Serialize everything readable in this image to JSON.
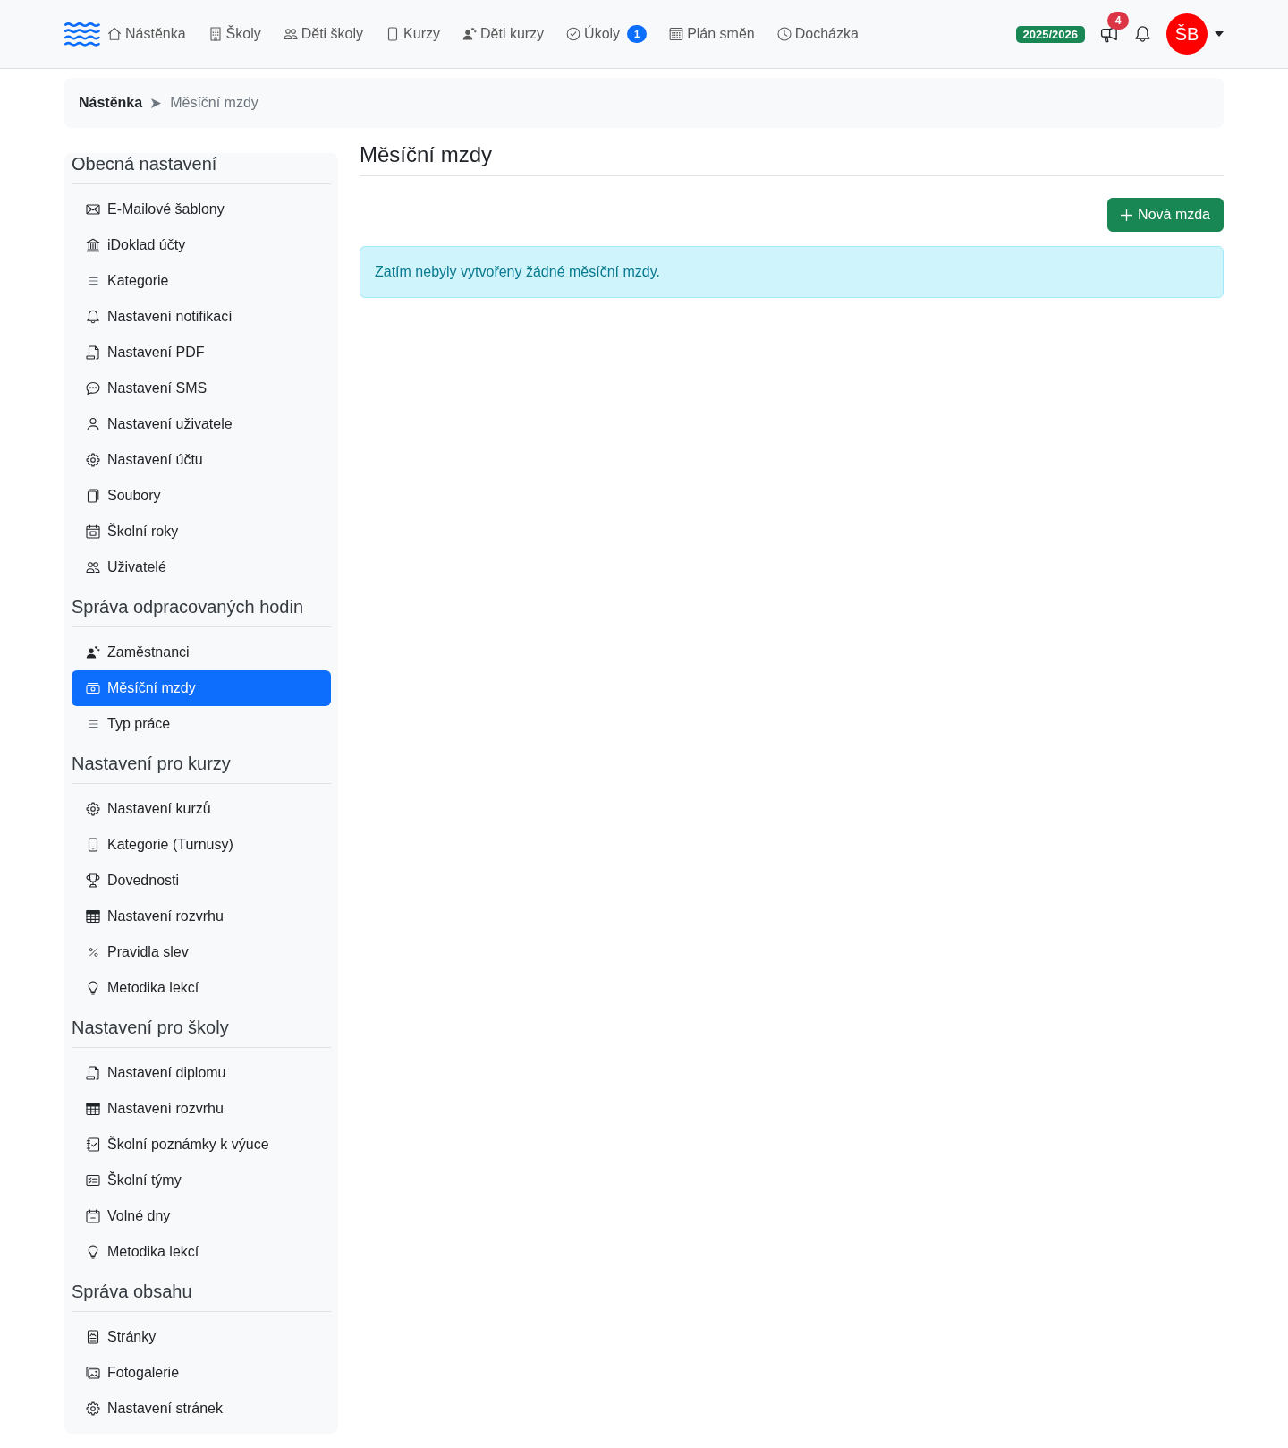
{
  "navbar": {
    "links": [
      {
        "label": "Nástěnka"
      },
      {
        "label": "Školy"
      },
      {
        "label": "Děti školy"
      },
      {
        "label": "Kurzy"
      },
      {
        "label": "Děti kurzy"
      },
      {
        "label": "Úkoly",
        "badge": "1"
      },
      {
        "label": "Plán směn"
      },
      {
        "label": "Docházka"
      }
    ],
    "school_year": "2025/2026",
    "announcements_count": "4",
    "user_initials": "ŠB"
  },
  "breadcrumb": [
    {
      "label": "Nástěnka",
      "current": false
    },
    {
      "label": "Měsíční mzdy",
      "current": true
    }
  ],
  "sidebar": {
    "sections": [
      {
        "title": "Obecná nastavení",
        "items": [
          {
            "label": "E-Mailové šablony",
            "selected": false
          },
          {
            "label": "iDoklad účty",
            "selected": false
          },
          {
            "label": "Kategorie",
            "selected": false
          },
          {
            "label": "Nastavení notifikací",
            "selected": false
          },
          {
            "label": "Nastavení PDF",
            "selected": false
          },
          {
            "label": "Nastavení SMS",
            "selected": false
          },
          {
            "label": "Nastavení uživatele",
            "selected": false
          },
          {
            "label": "Nastavení účtu",
            "selected": false
          },
          {
            "label": "Soubory",
            "selected": false
          },
          {
            "label": "Školní roky",
            "selected": false
          },
          {
            "label": "Uživatelé",
            "selected": false
          }
        ]
      },
      {
        "title": "Správa odpracovaných hodin",
        "items": [
          {
            "label": "Zaměstnanci",
            "selected": false
          },
          {
            "label": "Měsíční mzdy",
            "selected": true
          },
          {
            "label": "Typ práce",
            "selected": false
          }
        ]
      },
      {
        "title": "Nastavení pro kurzy",
        "items": [
          {
            "label": "Nastavení kurzů",
            "selected": false
          },
          {
            "label": "Kategorie (Turnusy)",
            "selected": false
          },
          {
            "label": "Dovednosti",
            "selected": false
          },
          {
            "label": "Nastavení rozvrhu",
            "selected": false
          },
          {
            "label": "Pravidla slev",
            "selected": false
          },
          {
            "label": "Metodika lekcí",
            "selected": false
          }
        ]
      },
      {
        "title": "Nastavení pro školy",
        "items": [
          {
            "label": "Nastavení diplomu",
            "selected": false
          },
          {
            "label": "Nastavení rozvrhu",
            "selected": false
          },
          {
            "label": "Školní poznámky k výuce",
            "selected": false
          },
          {
            "label": "Školní týmy",
            "selected": false
          },
          {
            "label": "Volné dny",
            "selected": false
          },
          {
            "label": "Metodika lekcí",
            "selected": false
          }
        ]
      },
      {
        "title": "Správa obsahu",
        "items": [
          {
            "label": "Stránky",
            "selected": false
          },
          {
            "label": "Fotogalerie",
            "selected": false
          },
          {
            "label": "Nastavení stránek",
            "selected": false
          }
        ]
      }
    ]
  },
  "main": {
    "title": "Měsíční mzdy",
    "new_button": "Nová mzda",
    "alert": "Zatím nebyly vytvořeny žádné měsíční mzdy."
  }
}
